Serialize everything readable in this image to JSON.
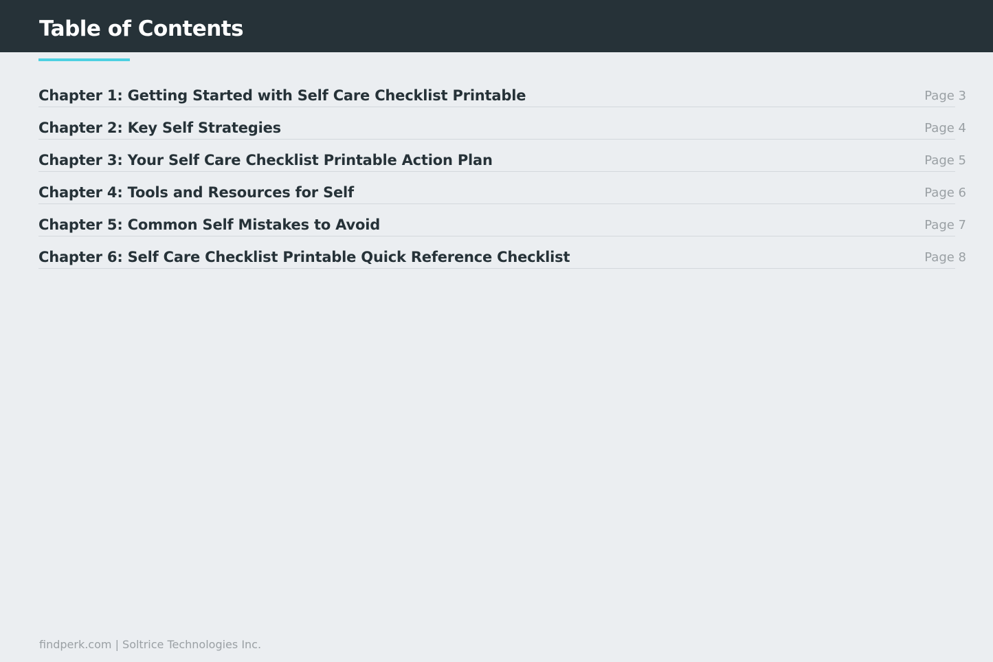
{
  "header": {
    "title": "Table of Contents"
  },
  "colors": {
    "header_background": "#263238",
    "accent": "#4dd0e1",
    "page_background": "#ebeef1",
    "entry_text": "#263238",
    "muted_text": "#9aa0a4"
  },
  "toc": {
    "entries": [
      {
        "title": "Chapter 1: Getting Started with Self Care Checklist Printable",
        "page": "Page 3"
      },
      {
        "title": "Chapter 2: Key Self Strategies",
        "page": "Page 4"
      },
      {
        "title": "Chapter 3: Your Self Care Checklist Printable Action Plan",
        "page": "Page 5"
      },
      {
        "title": "Chapter 4: Tools and Resources for Self",
        "page": "Page 6"
      },
      {
        "title": "Chapter 5: Common Self Mistakes to Avoid",
        "page": "Page 7"
      },
      {
        "title": "Chapter 6: Self Care Checklist Printable Quick Reference Checklist",
        "page": "Page 8"
      }
    ]
  },
  "footer": {
    "text": "findperk.com | Soltrice Technologies Inc."
  }
}
